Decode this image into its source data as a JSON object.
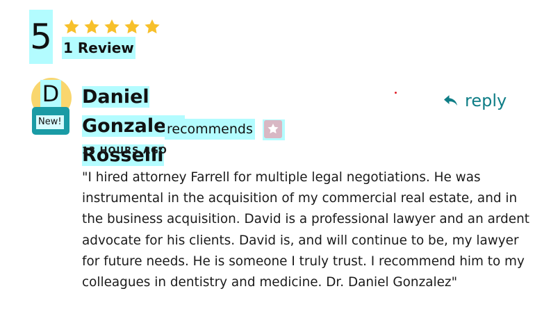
{
  "rating": {
    "score": "5",
    "stars": 5,
    "star_color": "#f7c02b",
    "count_label": "1 Review"
  },
  "review": {
    "avatar_initial": "D",
    "avatar_color": "#f9d66e",
    "new_badge": "New!",
    "reviewer_name_line1": "Daniel Gonzalez-",
    "reviewer_name_line2": "Rosselli",
    "recommends_label": "recommends",
    "recommend_icon": "star-badge-icon",
    "timestamp": "13 HOURS AGO",
    "reply_label": "reply",
    "reply_icon": "reply-arrow-icon",
    "accent_color": "#0e7d86",
    "text": "\"I hired attorney Farrell for multiple legal negotiations. He was instrumental in the acquisition of my commercial real estate, and in the business acquisition. David is a professional lawyer and an ardent advocate for his clients. David is, and will continue to be, my lawyer for future needs. He is someone I truly trust. I recommend him to my colleagues in dentistry and medicine. Dr. Daniel Gonzalez\""
  }
}
